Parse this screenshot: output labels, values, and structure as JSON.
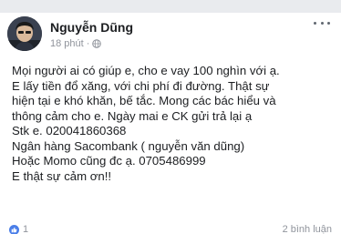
{
  "post": {
    "author": "Nguyễn Dũng",
    "timestamp": "18 phút",
    "separator": "·",
    "privacy_icon": "globe-icon",
    "more_icon": "more-options-icon",
    "text_lines": [
      "Mọi người ai có giúp e, cho e vay 100 nghìn với ạ.",
      "E lấy tiền đổ xăng, với chi phí đi đường. Thật sự",
      "hiện tại e khó khăn, bế tắc. Mong các bác hiểu và",
      "thông cảm cho e. Ngày mai e CK gửi trả lại ạ",
      "Stk e. 020041860368",
      "Ngân hàng Sacombank ( nguyễn văn dũng)",
      "Hoặc Momo cũng đc ạ. 0705486999",
      "E thật sự cảm ơn!!"
    ]
  },
  "footer": {
    "like_icon": "like-icon",
    "like_count": "1",
    "comment_count": "2 bình luận"
  },
  "colors": {
    "text": "#1c1e21",
    "meta": "#90949c",
    "like_blue": "#4a7ee8"
  }
}
